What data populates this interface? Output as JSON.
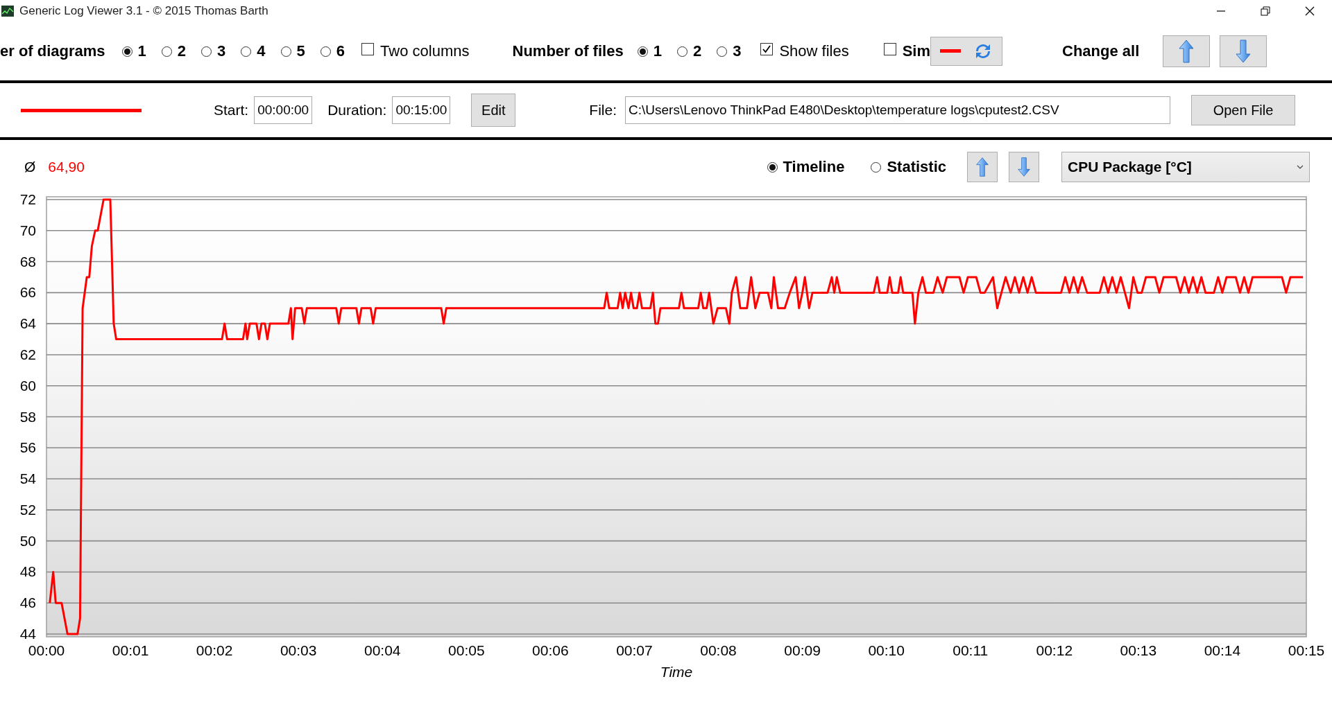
{
  "window": {
    "title": "Generic Log Viewer 3.1 - © 2015 Thomas Barth"
  },
  "toolbar": {
    "diagrams": {
      "label": "er of diagrams",
      "options": [
        {
          "label": "1",
          "selected": true
        },
        {
          "label": "2",
          "selected": false
        },
        {
          "label": "3",
          "selected": false
        },
        {
          "label": "4",
          "selected": false
        },
        {
          "label": "5",
          "selected": false
        },
        {
          "label": "6",
          "selected": false
        }
      ]
    },
    "two_columns": {
      "label": "Two columns",
      "checked": false
    },
    "files": {
      "label": "Number of files",
      "options": [
        {
          "label": "1",
          "selected": true
        },
        {
          "label": "2",
          "selected": false
        },
        {
          "label": "3",
          "selected": false
        }
      ]
    },
    "show_files": {
      "label": "Show files",
      "checked": true
    },
    "sim": {
      "label": "Sim",
      "checked": false
    },
    "change_all": {
      "label": "Change all"
    }
  },
  "file_row": {
    "color": "#ff0000",
    "start": {
      "label": "Start:",
      "value": "00:00:00"
    },
    "duration": {
      "label": "Duration:",
      "value": "00:15:00"
    },
    "edit_button": "Edit",
    "file": {
      "label": "File:",
      "value": "C:\\Users\\Lenovo ThinkPad E480\\Desktop\\temperature logs\\cputest2.CSV"
    },
    "open_button": "Open File"
  },
  "diagram": {
    "average_symbol": "Ø",
    "average": "64,90",
    "modes": [
      {
        "label": "Timeline",
        "selected": true
      },
      {
        "label": "Statistic",
        "selected": false
      }
    ],
    "chart_data": {
      "type": "line",
      "grid": true,
      "xlabel": "Time",
      "xlim": [
        0,
        15
      ],
      "ylim": [
        44,
        72
      ],
      "xticks": [
        {
          "value": 0,
          "label": "00:00"
        },
        {
          "value": 1,
          "label": "00:01"
        },
        {
          "value": 2,
          "label": "00:02"
        },
        {
          "value": 3,
          "label": "00:03"
        },
        {
          "value": 4,
          "label": "00:04"
        },
        {
          "value": 5,
          "label": "00:05"
        },
        {
          "value": 6,
          "label": "00:06"
        },
        {
          "value": 7,
          "label": "00:07"
        },
        {
          "value": 8,
          "label": "00:08"
        },
        {
          "value": 9,
          "label": "00:09"
        },
        {
          "value": 10,
          "label": "00:10"
        },
        {
          "value": 11,
          "label": "00:11"
        },
        {
          "value": 12,
          "label": "00:12"
        },
        {
          "value": 13,
          "label": "00:13"
        },
        {
          "value": 14,
          "label": "00:14"
        },
        {
          "value": 15,
          "label": "00:15"
        }
      ],
      "yticks": [
        44,
        46,
        48,
        50,
        52,
        54,
        56,
        58,
        60,
        62,
        64,
        66,
        68,
        70,
        72
      ],
      "x": [
        0.04,
        0.08,
        0.11,
        0.18,
        0.25,
        0.37,
        0.4,
        0.43,
        0.48,
        0.51,
        0.54,
        0.58,
        0.61,
        0.68,
        0.76,
        0.8,
        0.83,
        2.09,
        2.12,
        2.15,
        2.34,
        2.37,
        2.39,
        2.42,
        2.5,
        2.53,
        2.56,
        2.6,
        2.63,
        2.66,
        2.88,
        2.91,
        2.93,
        2.96,
        3.04,
        3.07,
        3.1,
        3.45,
        3.48,
        3.51,
        3.69,
        3.72,
        3.75,
        3.86,
        3.89,
        3.92,
        4.7,
        4.73,
        4.76,
        6.64,
        6.67,
        6.7,
        6.8,
        6.83,
        6.86,
        6.89,
        6.93,
        6.96,
        6.99,
        7.03,
        7.06,
        7.09,
        7.19,
        7.22,
        7.25,
        7.28,
        7.31,
        7.53,
        7.56,
        7.59,
        7.76,
        7.79,
        7.82,
        7.86,
        7.89,
        7.94,
        7.99,
        8.09,
        8.13,
        8.16,
        8.21,
        8.26,
        8.34,
        8.39,
        8.44,
        8.49,
        8.59,
        8.63,
        8.66,
        8.71,
        8.79,
        8.85,
        8.92,
        8.96,
        9.0,
        9.03,
        9.08,
        9.12,
        9.3,
        9.35,
        9.38,
        9.41,
        9.45,
        9.85,
        9.89,
        9.92,
        10.01,
        10.04,
        10.07,
        10.14,
        10.17,
        10.2,
        10.31,
        10.34,
        10.38,
        10.43,
        10.47,
        10.56,
        10.61,
        10.67,
        10.72,
        10.87,
        10.92,
        10.97,
        11.07,
        11.12,
        11.17,
        11.27,
        11.32,
        11.37,
        11.42,
        11.48,
        11.53,
        11.58,
        11.63,
        11.68,
        11.73,
        11.78,
        12.08,
        12.13,
        12.18,
        12.23,
        12.28,
        12.33,
        12.39,
        12.54,
        12.59,
        12.64,
        12.69,
        12.74,
        12.79,
        12.84,
        12.89,
        12.94,
        12.99,
        13.04,
        13.09,
        13.2,
        13.25,
        13.3,
        13.45,
        13.5,
        13.55,
        13.6,
        13.65,
        13.7,
        13.75,
        13.8,
        13.9,
        13.95,
        14.0,
        14.05,
        14.16,
        14.21,
        14.26,
        14.31,
        14.36,
        14.71,
        14.76,
        14.81,
        14.96
      ],
      "series": [
        {
          "name": "CPU Package [°C]",
          "color": "#ff0000",
          "values": [
            46,
            48,
            46,
            46,
            44,
            44,
            45,
            65,
            67,
            67,
            69,
            70,
            70,
            72,
            72,
            64,
            63,
            63,
            64,
            63,
            63,
            64,
            63,
            64,
            64,
            63,
            64,
            64,
            63,
            64,
            64,
            65,
            63,
            65,
            65,
            64,
            65,
            65,
            64,
            65,
            65,
            64,
            65,
            65,
            64,
            65,
            65,
            64,
            65,
            65,
            66,
            65,
            65,
            66,
            65,
            66,
            65,
            66,
            65,
            65,
            66,
            65,
            65,
            66,
            64,
            64,
            65,
            65,
            66,
            65,
            65,
            66,
            65,
            65,
            66,
            64,
            65,
            65,
            64,
            66,
            67,
            65,
            65,
            67,
            65,
            66,
            66,
            65,
            67,
            65,
            65,
            66,
            67,
            65,
            66,
            67,
            65,
            66,
            66,
            67,
            66,
            67,
            66,
            66,
            67,
            66,
            66,
            67,
            66,
            66,
            67,
            66,
            66,
            64,
            66,
            67,
            66,
            66,
            67,
            66,
            67,
            67,
            66,
            67,
            67,
            66,
            66,
            67,
            65,
            66,
            67,
            66,
            67,
            66,
            67,
            66,
            67,
            66,
            66,
            67,
            66,
            67,
            66,
            67,
            66,
            66,
            67,
            66,
            67,
            66,
            67,
            66,
            65,
            67,
            66,
            66,
            67,
            67,
            66,
            67,
            67,
            66,
            67,
            66,
            67,
            66,
            67,
            66,
            66,
            67,
            66,
            67,
            67,
            66,
            67,
            66,
            67,
            67,
            66,
            67,
            67
          ]
        }
      ]
    }
  }
}
